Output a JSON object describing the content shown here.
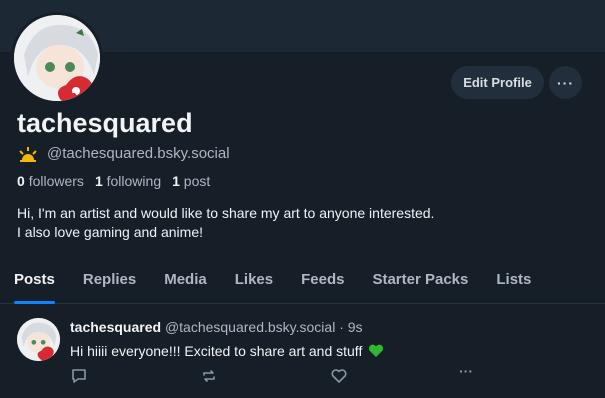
{
  "profile": {
    "display_name": "tachesquared",
    "handle": "@tachesquared.bsky.social",
    "followers_count": "0",
    "followers_label": "followers",
    "following_count": "1",
    "following_label": "following",
    "posts_count": "1",
    "posts_label": "post",
    "bio_line1": "Hi, I'm an artist and would like to share my art to anyone interested.",
    "bio_line2": "I also love gaming and anime!",
    "edit_label": "Edit Profile",
    "more_label": "···"
  },
  "tabs": [
    {
      "label": "Posts",
      "active": true
    },
    {
      "label": "Replies",
      "active": false
    },
    {
      "label": "Media",
      "active": false
    },
    {
      "label": "Likes",
      "active": false
    },
    {
      "label": "Feeds",
      "active": false
    },
    {
      "label": "Starter Packs",
      "active": false
    },
    {
      "label": "Lists",
      "active": false
    }
  ],
  "post": {
    "author": "tachesquared",
    "handle": "@tachesquared.bsky.social",
    "separator": "·",
    "time": "9s",
    "text": "Hi hiiii everyone!!! Excited to share art and stuff",
    "emoji_icon": "green-heart-icon",
    "actions": [
      "reply-icon",
      "repost-icon",
      "like-icon",
      "more-icon"
    ],
    "more_label": "···"
  },
  "colors": {
    "background": "#161e27",
    "accent": "#1083fe",
    "muted_text": "#aeb7c2",
    "green_heart": "#2fb92f"
  }
}
